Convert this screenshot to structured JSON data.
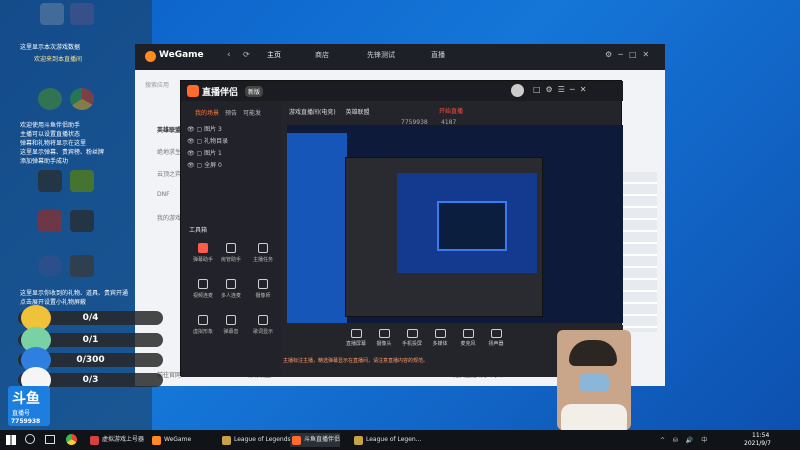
{
  "colors": {
    "desktop": "#1576d8",
    "taskbar": "#101317",
    "accent_red": "#e8362b",
    "wegame_dark": "#1d2027"
  },
  "chat_overlay": {
    "lines": [
      "这里显示本次游戏数据",
      "欢迎来到本直播间",
      "欢迎使用斗鱼伴侣助手",
      "主播可以设置直播状态",
      "弹幕和礼物将显示在这里",
      "这里显示弹幕、贵宾榜、粉丝牌",
      "添加弹幕助手成功",
      "这里显示你收到的礼物、道具、贵宾开通",
      "点击展开设置小礼物屏蔽"
    ],
    "counters": [
      {
        "value": "0/4",
        "icon": "gift-bear-icon",
        "color": "#f0c23a"
      },
      {
        "value": "0/1",
        "icon": "diamond-icon",
        "color": "#7ad1a3"
      },
      {
        "value": "0/300",
        "icon": "shield-icon",
        "color": "#2f7fe0"
      },
      {
        "value": "0/3",
        "icon": "panda-icon",
        "color": "#f5f5f5"
      }
    ],
    "logo_text": "斗鱼",
    "logo_sub": "直播号",
    "room_id": "7759938"
  },
  "wegame": {
    "brand": "WeGame",
    "tabs": [
      "主页",
      "商店",
      "先锋测试",
      "直播"
    ],
    "search_placeholder": "搜索应用",
    "left_items": [
      "英雄联盟",
      "绝地求生",
      "云顶之弈",
      "DNF",
      "我的游戏"
    ],
    "bottom_left": "前往官网",
    "bottom_mid": "辅助设置",
    "bottom_right": "比赛直播助手 网络"
  },
  "assistant": {
    "title": "直播伴侣",
    "version_badge": "新版",
    "tabs": [
      "我的场景",
      "预告",
      "可能发"
    ],
    "room_line": "游戏直播间(电竞)",
    "sub_line": "英雄联盟",
    "room_no": "7759938",
    "fans": "4187",
    "live_button": "开始直播",
    "sources": [
      "图片 3",
      "礼物目录",
      "图片 1",
      "全屏 0"
    ],
    "tools_label": "工具箱",
    "tools": [
      {
        "label": "弹幕助手",
        "icon": "danmu-icon",
        "red": true
      },
      {
        "label": "房管助手",
        "icon": "user-icon",
        "red": false
      },
      {
        "label": "主播任务",
        "icon": "task-icon",
        "red": false
      },
      {
        "label": "视频连麦",
        "icon": "video-icon",
        "red": false
      },
      {
        "label": "多人连麦",
        "icon": "mic-group-icon",
        "red": false
      },
      {
        "label": "摄像师",
        "icon": "camera-icon",
        "red": false
      },
      {
        "label": "虚拟形象",
        "icon": "avatar-icon",
        "red": false
      },
      {
        "label": "弹幕音",
        "icon": "sound-icon",
        "red": false
      },
      {
        "label": "歌词显示",
        "icon": "lyrics-icon",
        "red": false
      }
    ],
    "bottom_tools": [
      "直播屏幕",
      "摄像头",
      "手机投屏",
      "多媒体",
      "麦克风",
      "扬声器"
    ],
    "notice": "主播标注主播，精选弹幕显示在直播间，请注意直播内容的规范。"
  },
  "taskbar": {
    "items": [
      {
        "label": "虚拟游戏上号器",
        "color": "#d94141"
      },
      {
        "label": "WeGame",
        "color": "#ff8a1f"
      },
      {
        "label": "League of Legends",
        "color": "#c8a148"
      },
      {
        "label": "斗鱼直播伴侣",
        "color": "#ff6b2e"
      },
      {
        "label": "League of Legen...",
        "color": "#c8a148"
      }
    ],
    "time": "11:54",
    "date": "2021/9/7"
  }
}
